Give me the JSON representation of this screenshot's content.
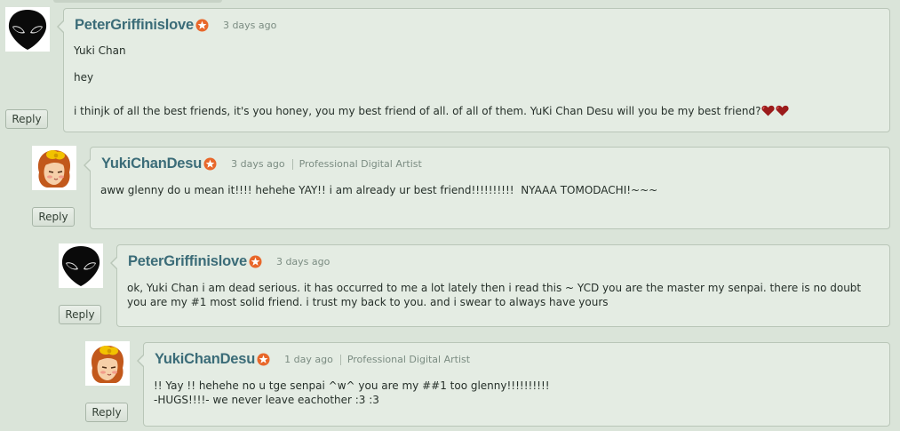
{
  "comments": [
    {
      "username": "PeterGriffinislove",
      "time": "3 days ago",
      "role": "",
      "lines": [
        "Yuki Chan",
        "hey",
        "i thinjk of all the best friends, it's you honey, you my best friend of all. of all of them. YuKi Chan Desu will you be my best friend?"
      ],
      "reply": "Reply",
      "avatar": "alien-avatar"
    },
    {
      "username": "YukiChanDesu",
      "time": "3 days ago",
      "role": "Professional Digital Artist",
      "lines": [
        "aww glenny do u mean it!!!! hehehe YAY!! i am already ur best friend!!!!!!!!!!  NYAAA TOMODACHI!~~~"
      ],
      "reply": "Reply",
      "avatar": "anime-girl-avatar"
    },
    {
      "username": "PeterGriffinislove",
      "time": "3 days ago",
      "role": "",
      "lines": [
        "ok, Yuki Chan i am dead serious. it has occurred to me a lot lately then i read this ~ YCD you are the master my senpai. there is no doubt you are my #1 most solid friend. i trust my back to you. and i swear to always have yours"
      ],
      "reply": "Reply",
      "avatar": "alien-avatar"
    },
    {
      "username": "YukiChanDesu",
      "time": "1 day ago",
      "role": "Professional Digital Artist",
      "lines": [
        "!! Yay !! hehehe no u tge senpai ^w^ you are my ##1 too glenny!!!!!!!!!!",
        "-HUGS!!!!- we never leave eachother :3 :3"
      ],
      "reply": "Reply",
      "avatar": "anime-girl-avatar"
    }
  ],
  "colors": {
    "username": "#3b6c78",
    "badge": "#e8672a",
    "heart": "#9b1b1b",
    "background": "#dae4d9",
    "bubble": "#e4ece3"
  }
}
